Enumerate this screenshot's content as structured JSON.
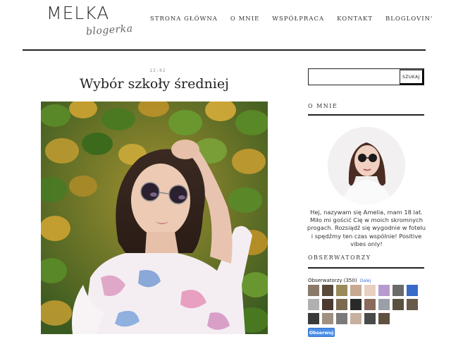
{
  "blog": {
    "logo_main": "MELKA",
    "logo_sub": "blogerka"
  },
  "nav": {
    "items": [
      {
        "label": "STRONA GŁÓWNA"
      },
      {
        "label": "O MNIE"
      },
      {
        "label": "WSPÓŁPRACA"
      },
      {
        "label": "KONTAKT"
      },
      {
        "label": "BLOGLOVIN'"
      }
    ]
  },
  "post": {
    "time": "22:02",
    "title": "Wybór szkoły średniej"
  },
  "sidebar": {
    "search": {
      "value": "",
      "button_label": "SZUKAJ"
    },
    "about": {
      "title": "O MNIE",
      "text": "Hej, nazywam się Amelia, mam 18 lat. Miło mi gościć Cię w moich skromnych progach. Rozsiądź się wygodnie w fotelu i spędźmy ten czas wspólnie! Positive vibes only!"
    },
    "followers": {
      "title": "OBSERWATORZY",
      "label": "Obserwatorzy (350)",
      "more_link": "Dalej",
      "follow_button": "Obserwuj",
      "thumb_colors": [
        "#8a7a6a",
        "#5a4a3a",
        "#9a8a5a",
        "#c8a890",
        "#e8d0c0",
        "#b89ad0",
        "#6a6a6a",
        "#3a6ac8",
        "#b0b0b0",
        "#4a3a30",
        "#7a6a50",
        "#2a2a2a",
        "#8a6a5a",
        "#9aa0a8",
        "#5a5040",
        "#6a5a4a",
        "#3a3a3a",
        "#a09080",
        "#7a7a7a",
        "#c8b0a0",
        "#4a4a4a",
        "#605040"
      ]
    }
  }
}
